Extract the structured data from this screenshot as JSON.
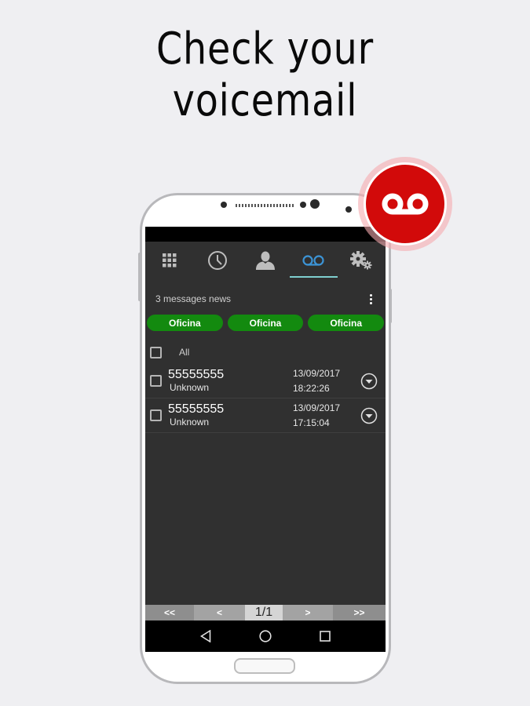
{
  "headline": {
    "line1": "Check your",
    "line2": "voicemail"
  },
  "badge": {
    "icon": "voicemail-icon",
    "color": "#d20a0a"
  },
  "app": {
    "tabs": [
      {
        "name": "dialpad",
        "icon": "dialpad-icon",
        "active": false
      },
      {
        "name": "recents",
        "icon": "clock-icon",
        "active": false
      },
      {
        "name": "contacts",
        "icon": "person-icon",
        "active": false
      },
      {
        "name": "voicemail",
        "icon": "voicemail-icon",
        "active": true
      },
      {
        "name": "settings",
        "icon": "gear-icon",
        "active": false
      }
    ],
    "accent_color": "#7ecfcf",
    "message_count_text": "3 messages news",
    "mailboxes": [
      "Oficina",
      "Oficina",
      "Oficina"
    ],
    "mailbox_color": "#138a0f",
    "select_all_label": "All",
    "messages": [
      {
        "number": "55555555",
        "name": "Unknown",
        "date": "13/09/2017",
        "time": "18:22:26"
      },
      {
        "number": "55555555",
        "name": "Unknown",
        "date": "13/09/2017",
        "time": "17:15:04"
      }
    ],
    "pager": {
      "first": "<<",
      "prev": "<",
      "current": "1/1",
      "next": ">",
      "last": ">>"
    }
  }
}
